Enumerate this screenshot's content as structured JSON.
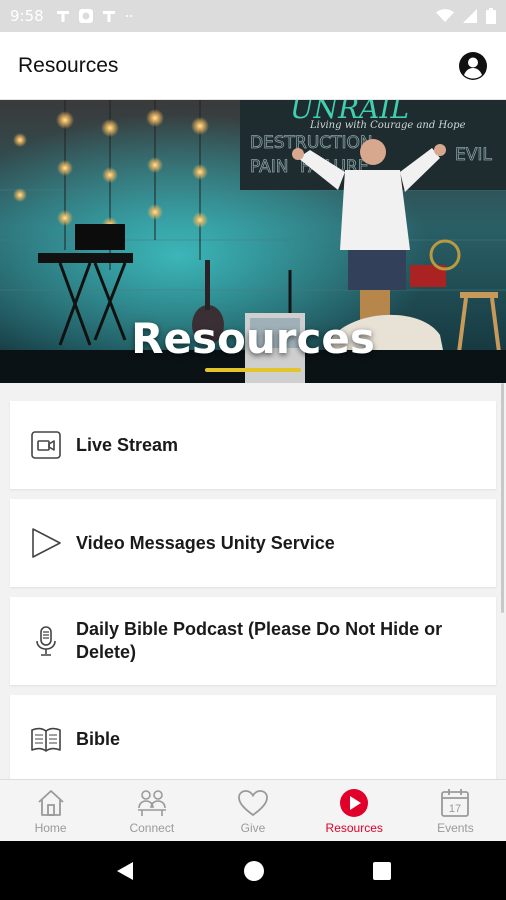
{
  "status_bar": {
    "time": "9:58"
  },
  "app_bar": {
    "title": "Resources"
  },
  "hero": {
    "title": "Resources",
    "screen_text_top": "UNRAIL",
    "screen_subtitle": "Living with Courage and Hope",
    "screen_words": [
      "DESTRUCTION",
      "PAIN",
      "FAILURE",
      "EVIL"
    ]
  },
  "items": [
    {
      "label": "Live Stream",
      "icon": "video-camera-icon"
    },
    {
      "label": "Video Messages Unity Service",
      "icon": "play-icon"
    },
    {
      "label": "Daily Bible Podcast (Please Do Not Hide or Delete)",
      "icon": "microphone-icon"
    },
    {
      "label": "Bible",
      "icon": "book-icon"
    }
  ],
  "nav": [
    {
      "label": "Home",
      "icon": "home-icon"
    },
    {
      "label": "Connect",
      "icon": "people-icon"
    },
    {
      "label": "Give",
      "icon": "heart-icon"
    },
    {
      "label": "Resources",
      "icon": "play-circle-icon",
      "active": true
    },
    {
      "label": "Events",
      "icon": "calendar-icon",
      "day": "17"
    }
  ],
  "colors": {
    "accent": "#e0002a",
    "hero_underline": "#e4c42b",
    "status_bar": "#dcdcdc"
  }
}
